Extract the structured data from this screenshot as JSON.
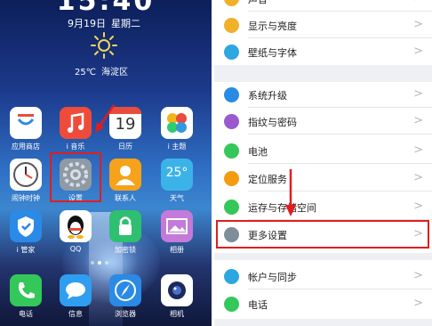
{
  "home": {
    "time": "15:40",
    "date": "9月19日",
    "weekday": "星期二",
    "temperature": "25℃",
    "location": "海淀区",
    "apps": [
      {
        "label": "应用商店",
        "icon": "app-store-icon",
        "color": "#ffffff"
      },
      {
        "label": "i 音乐",
        "icon": "music-icon",
        "color": "#ef4b3a"
      },
      {
        "label": "日历",
        "icon": "calendar-icon",
        "color": "#ffffff",
        "badge": "19"
      },
      {
        "label": "i 主题",
        "icon": "theme-icon",
        "color": "#ffffff"
      },
      {
        "label": "闹钟时钟",
        "icon": "clock-icon",
        "color": "#ffffff"
      },
      {
        "label": "设置",
        "icon": "settings-gear-icon",
        "color": "#8e9aa6"
      },
      {
        "label": "联系人",
        "icon": "contacts-icon",
        "color": "#f6a21a"
      },
      {
        "label": "天气",
        "icon": "weather-icon",
        "color": "#3cb3e8",
        "badge": "25°"
      },
      {
        "label": "i 管家",
        "icon": "shield-icon",
        "color": "#2a8ae6"
      },
      {
        "label": "QQ",
        "icon": "qq-penguin-icon",
        "color": "#ffffff"
      },
      {
        "label": "加密锁",
        "icon": "lock-icon",
        "color": "#2fbf71"
      },
      {
        "label": "相册",
        "icon": "gallery-icon",
        "color": "#c47ad9"
      },
      {
        "label": "电话",
        "icon": "phone-icon",
        "color": "#34c759"
      },
      {
        "label": "信息",
        "icon": "message-icon",
        "color": "#2f9ef0"
      },
      {
        "label": "浏览器",
        "icon": "browser-icon",
        "color": "#2a8ae6"
      },
      {
        "label": "相机",
        "icon": "camera-icon",
        "color": "#ffffff"
      }
    ]
  },
  "settings": {
    "items": [
      {
        "label": "声音",
        "icon": "sound-icon",
        "color": "#f0b02a"
      },
      {
        "label": "显示与亮度",
        "icon": "brightness-icon",
        "color": "#f0b02a"
      },
      {
        "label": "壁纸与字体",
        "icon": "wallpaper-font-icon",
        "color": "#2ea6e0"
      },
      {
        "label": "系统升级",
        "icon": "system-upgrade-icon",
        "color": "#2a8ae6"
      },
      {
        "label": "指纹与密码",
        "icon": "fingerprint-icon",
        "color": "#9b59d0"
      },
      {
        "label": "电池",
        "icon": "battery-icon",
        "color": "#34c759"
      },
      {
        "label": "定位服务",
        "icon": "location-icon",
        "color": "#f39c12"
      },
      {
        "label": "运存与存储空间",
        "icon": "storage-icon",
        "color": "#34c759"
      },
      {
        "label": "更多设置",
        "icon": "wrench-icon",
        "color": "#7f8c99"
      },
      {
        "label": "帐户与同步",
        "icon": "account-sync-icon",
        "color": "#2ea6e0"
      },
      {
        "label": "电话",
        "icon": "phone-icon",
        "color": "#34c759"
      }
    ],
    "chevron": ">"
  },
  "colors": {
    "highlight": "#e21d1d"
  }
}
